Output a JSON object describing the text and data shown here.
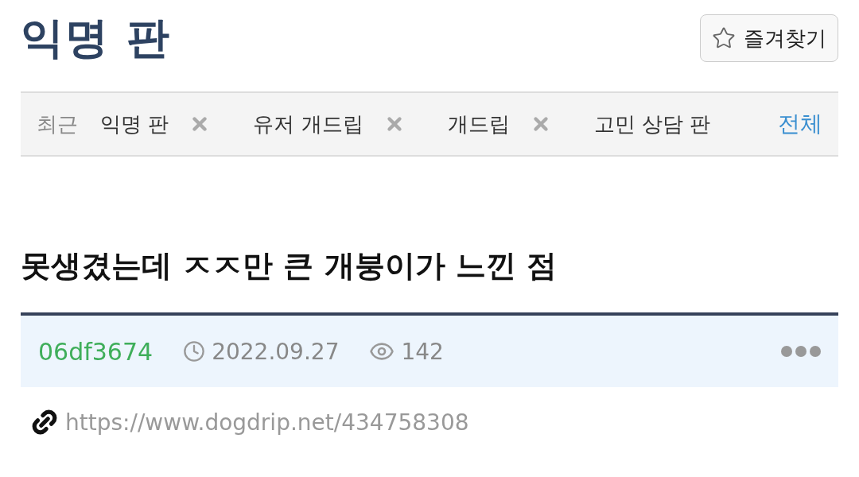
{
  "board": {
    "title": "익명 판",
    "favorite_button": "즐겨찾기"
  },
  "recent": {
    "label": "최근",
    "items": [
      {
        "label": "익명 판",
        "removable": true
      },
      {
        "label": "유저 개드립",
        "removable": true
      },
      {
        "label": "개드립",
        "removable": true
      },
      {
        "label": "고민 상담 판",
        "removable": false
      }
    ],
    "all_link": "전체"
  },
  "post": {
    "title": "못생겼는데 ㅈㅈ만 큰 개붕이가 느낀 점",
    "author": "06df3674",
    "date": "2022.09.27",
    "views": "142",
    "url": "https://www.dogdrip.net/434758308"
  }
}
